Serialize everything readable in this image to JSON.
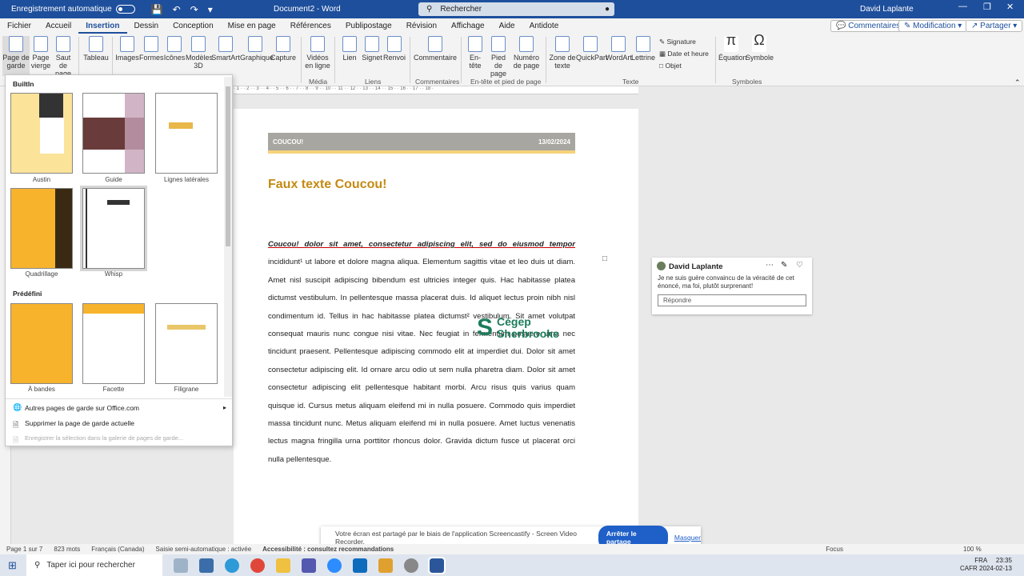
{
  "titlebar": {
    "autosave_label": "Enregistrement automatique",
    "doc_name": "Document2  -  Word",
    "search_placeholder": "Rechercher",
    "user_name": "David Laplante"
  },
  "menu": {
    "tabs": [
      "Fichier",
      "Accueil",
      "Insertion",
      "Dessin",
      "Conception",
      "Mise en page",
      "Références",
      "Publipostage",
      "Révision",
      "Affichage",
      "Aide",
      "Antidote"
    ],
    "active_tab": "Insertion",
    "comments_btn": "Commentaires",
    "edit_btn": "Modification",
    "share_btn": "Partager"
  },
  "ribbon": {
    "page_de_garde": "Page de garde",
    "page_vierge": "Page vierge",
    "saut_page": "Saut de page",
    "tableau": "Tableau",
    "images": "Images",
    "formes": "Formes",
    "icones": "Icônes",
    "modeles3d": "Modèles 3D",
    "smartart": "SmartArt",
    "graphique": "Graphique",
    "capture": "Capture",
    "videos": "Vidéos en ligne",
    "lien": "Lien",
    "signet": "Signet",
    "renvoi": "Renvoi",
    "commentaire": "Commentaire",
    "entete": "En-tête",
    "pied": "Pied de page",
    "numero": "Numéro de page",
    "zone": "Zone de texte",
    "quickpart": "QuickPart",
    "wordart": "WordArt",
    "lettrine": "Lettrine",
    "signature": "Signature",
    "date_heure": "Date et heure",
    "objet": "Objet",
    "equation": "Équation",
    "symbole": "Symbole",
    "grp_media": "Média",
    "grp_liens": "Liens",
    "grp_commentaires": "Commentaires",
    "grp_entete": "En-tête et pied de page",
    "grp_texte": "Texte",
    "grp_symboles": "Symboles"
  },
  "gallery": {
    "builtin": "BuiltIn",
    "predefini": "Prédéfini",
    "items": [
      "Austin",
      "Guide",
      "Lignes latérales",
      "Quadrillage",
      "Whisp",
      "À bandes",
      "Facette",
      "Filigrane"
    ],
    "menu_more": "Autres pages de garde sur Office.com",
    "menu_delete": "Supprimer la page de garde actuelle",
    "menu_save": "Enregistrer la sélection dans la galerie de pages de garde..."
  },
  "document": {
    "header_left": "COUCOU!",
    "header_right": "13/02/2024",
    "title": "Faux texte Coucou!",
    "para_bold": "Coucou! dolor sit amet, consectetur adipiscing elit, sed do eiusmod tempor",
    "para_body": "incididunt¹ ut labore et dolore magna aliqua. Elementum sagittis vitae et leo duis ut diam. Amet nisl suscipit adipiscing bibendum est ultricies integer quis. Hac habitasse platea dictumst vestibulum. In pellentesque massa placerat duis. Id aliquet lectus proin nibh nisl condimentum id. Tellus in hac habitasse platea dictumst² vestibulum. Sit amet volutpat consequat mauris nunc congue nisi vitae. Nec feugiat in fermentum posuere urna nec tincidunt praesent. Pellentesque adipiscing commodo elit at imperdiet dui. Dolor sit amet consectetur adipiscing elit. Id ornare arcu odio ut sem nulla pharetra diam. Dolor sit amet consectetur adipiscing elit pellentesque habitant morbi. Arcu risus quis varius quam quisque id. Cursus metus aliquam eleifend mi in nulla posuere. Commodo quis imperdiet massa tincidunt nunc. Metus aliquam eleifend mi in nulla posuere. Amet luctus venenatis lectus magna fringilla urna porttitor rhoncus dolor. Gravida dictum fusce ut placerat orci nulla pellentesque.",
    "logo_line1": "Cégep",
    "logo_line2": "Sherbrooke"
  },
  "comment": {
    "author": "David Laplante",
    "text": "Je ne suis guère convaincu de la véracité de cet énoncé, ma foi, plutôt surprenant!",
    "reply_placeholder": "Répondre"
  },
  "share_banner": {
    "text": "Votre écran est partagé par le biais de l'application Screencastify - Screen Video Recorder.",
    "stop": "Arrêter le partage",
    "hide": "Masquer"
  },
  "status": {
    "page": "Page 1 sur 7",
    "words": "823 mots",
    "lang": "Français (Canada)",
    "mode": "Saisie semi-automatique : activée",
    "access": "Accessibilité : consultez recommandations",
    "focus": "Focus",
    "zoom": "100 %"
  },
  "taskbar": {
    "search": "Taper ici pour rechercher",
    "lang": "FRA",
    "locale": "CAFR",
    "time": "23:35",
    "date": "2024-02-13"
  }
}
